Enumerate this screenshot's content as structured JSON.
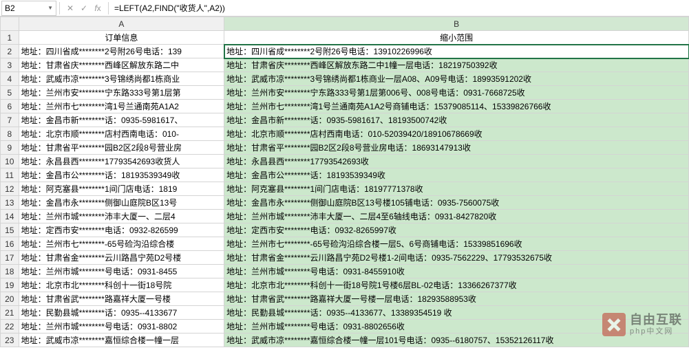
{
  "name_box": "B2",
  "formula": "=LEFT(A2,FIND(\"收货人\",A2))",
  "col_headers": [
    "A",
    "B"
  ],
  "header_row": {
    "a": "订单信息",
    "b": "缩小范围"
  },
  "rows": [
    {
      "n": "2",
      "a": "地址：四川省成********2号附26号电话：139",
      "b": "地址：四川省成********2号附26号电话：13910226996收"
    },
    {
      "n": "3",
      "a": "地址：甘肃省庆********西峰区解放东路二中",
      "b": "地址：甘肃省庆********西峰区解放东路二中1幢一层电话：18219750392收"
    },
    {
      "n": "4",
      "a": "地址：武威市凉********3号锦绣尚都1栋商业",
      "b": "地址：武威市凉********3号锦绣尚都1栋商业一层A08、A09号电话：18993591202收"
    },
    {
      "n": "5",
      "a": "地址：兰州市安********宁东路333号第1层第",
      "b": "地址：兰州市安********宁东路333号第1层第006号、008号电话：0931-7668725收"
    },
    {
      "n": "6",
      "a": "地址：兰州市七********湾1号兰通南苑A1A2",
      "b": "地址：兰州市七********湾1号兰通南苑A1A2号商铺电话：15379085114、15339826766收"
    },
    {
      "n": "7",
      "a": "地址：金昌市新********话：0935-5981617、",
      "b": "地址：金昌市新********话：0935-5981617、18193500742收"
    },
    {
      "n": "8",
      "a": "地址：北京市顺********店村西南电话：010-",
      "b": "地址：北京市顺********店村西南电话：010-52039420/18910678669收"
    },
    {
      "n": "9",
      "a": "地址：甘肃省平********园B2区2段8号营业房",
      "b": "地址：甘肃省平********园B2区2段8号营业房电话：18693147913收"
    },
    {
      "n": "10",
      "a": "地址：永昌县西********17793542693收货人",
      "b": "地址：永昌县西********17793542693收"
    },
    {
      "n": "11",
      "a": "地址：金昌市公********话：18193539349收",
      "b": "地址：金昌市公********话：18193539349收"
    },
    {
      "n": "12",
      "a": "地址：阿克塞县********1间门店电话：1819",
      "b": "地址：阿克塞县********1间门店电话：18197771378收"
    },
    {
      "n": "13",
      "a": "地址：金昌市永********侧御山庭院B区13号",
      "b": "地址：金昌市永********侧御山庭院B区13号楼105铺电话：0935-7560075收"
    },
    {
      "n": "14",
      "a": "地址：兰州市城********沛丰大厦一、二层4",
      "b": "地址：兰州市城********沛丰大厦一、二层4至6轴线电话：0931-8427820收"
    },
    {
      "n": "15",
      "a": "地址：定西市安********电话：0932-826599",
      "b": "地址：定西市安********电话：0932-8265997收"
    },
    {
      "n": "16",
      "a": "地址：兰州市七********-65号硷沟沿综合楼",
      "b": "地址：兰州市七********-65号硷沟沿综合楼一层5、6号商铺电话：15339851696收"
    },
    {
      "n": "17",
      "a": "地址：甘肃省金********云川路昌宁苑D2号楼",
      "b": "地址：甘肃省金********云川路昌宁苑D2号楼1-2间电话：0935-7562229、17793532675收"
    },
    {
      "n": "18",
      "a": "地址：兰州市城********号电话：0931-8455",
      "b": "地址：兰州市城********号电话：0931-8455910收"
    },
    {
      "n": "19",
      "a": "地址：北京市北********科创十一街18号院",
      "b": "地址：北京市北********科创十一街18号院1号楼6层BL-02电话：13366267377收"
    },
    {
      "n": "20",
      "a": "地址：甘肃省武********路嘉祥大厦一号楼",
      "b": "地址：甘肃省武********路嘉祥大厦一号楼一层电话：18293588953收"
    },
    {
      "n": "21",
      "a": "地址：民勤县城********话：0935--4133677",
      "b": "地址：民勤县城********话：0935--4133677、13389354519 收"
    },
    {
      "n": "22",
      "a": "地址：兰州市城********号电话：0931-8802",
      "b": "地址：兰州市城********号电话：0931-8802656收"
    },
    {
      "n": "23",
      "a": "地址：武威市凉********嘉恒综合楼一幢一层",
      "b": "地址：武威市凉********嘉恒综合楼一幢一层101号电话：0935--6180757、15352126117收"
    }
  ],
  "watermark": {
    "main": "自由互联",
    "sub": "php中文网"
  }
}
